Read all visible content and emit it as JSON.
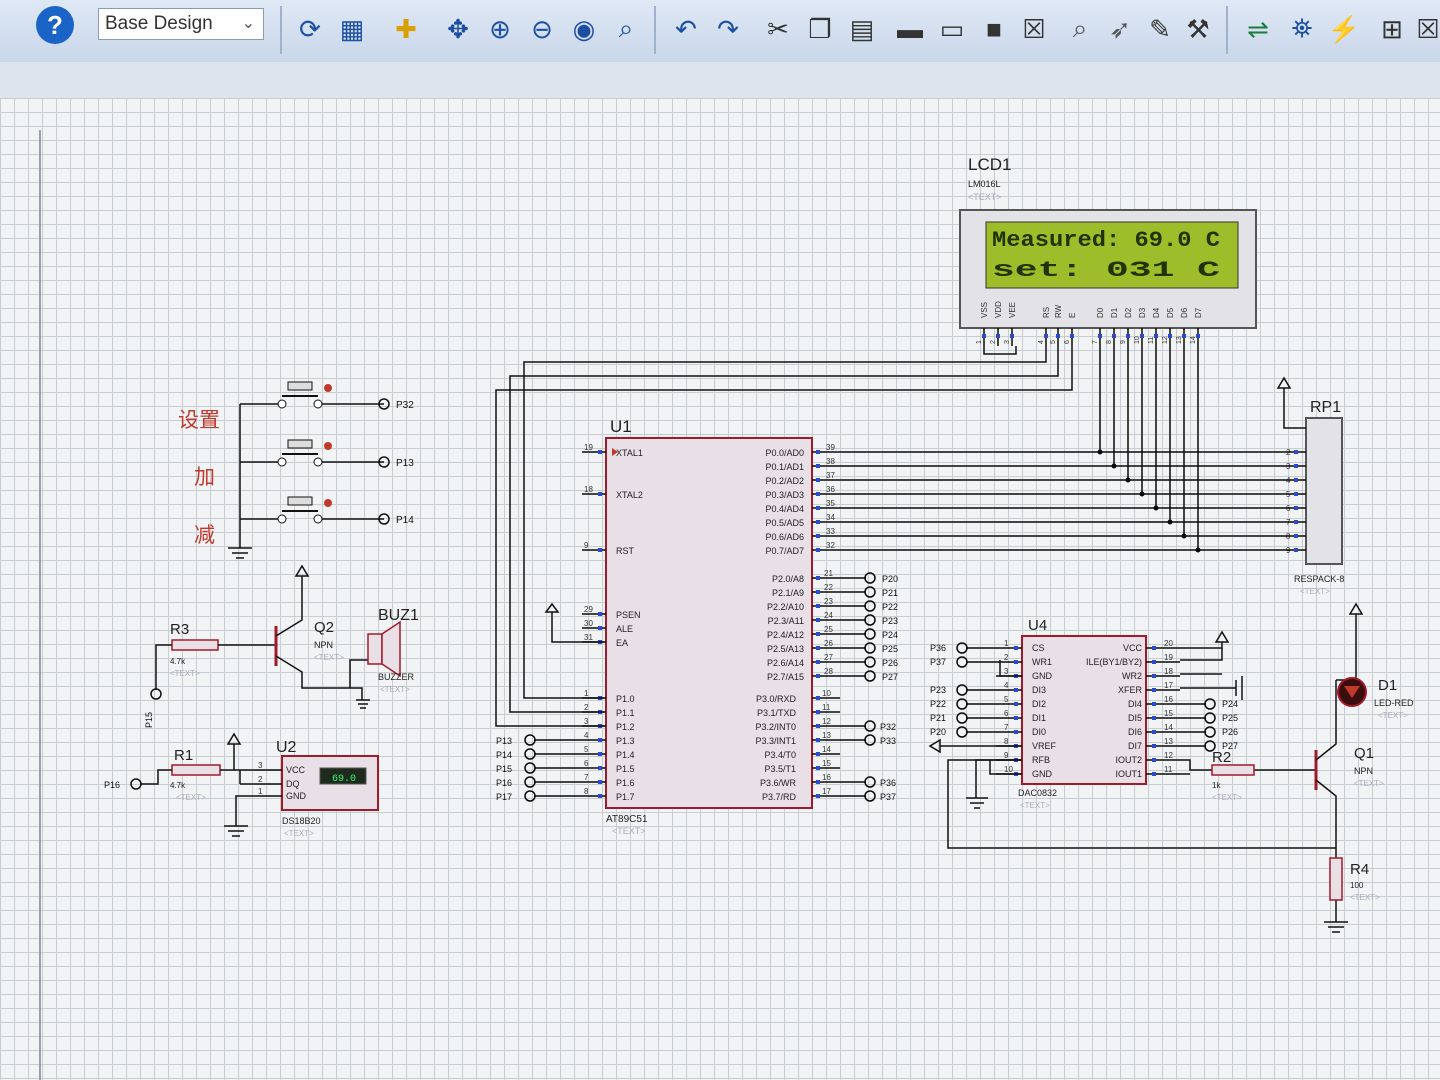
{
  "toolbar": {
    "help_label": "?",
    "design_select_value": "Base Design",
    "buttons": [
      "refresh",
      "grid",
      "origin",
      "pan",
      "zoom-in",
      "zoom-out",
      "zoom-all",
      "zoom-area",
      "undo",
      "redo",
      "cut",
      "copy",
      "paste",
      "block-copy",
      "block-move",
      "block-rotate",
      "block-delete",
      "pick",
      "make-device",
      "packaging",
      "decompose",
      "wire-autorouter",
      "search",
      "property-assignment",
      "new-sheet",
      "remove-sheet"
    ]
  },
  "colors": {
    "wire": "#0a0a0a",
    "component_outline": "#a11a2a",
    "component_fill": "#e9dfe6",
    "pin_marker": "#2b4bcc",
    "label_red": "#c0392b",
    "lcd_bg": "#9dbd2a",
    "lcd_text": "#223300"
  },
  "buttons": {
    "set_label": "设置",
    "inc_label": "加",
    "dec_label": "减",
    "set_terminal": "P32",
    "inc_terminal": "P13",
    "dec_terminal": "P14"
  },
  "lcd": {
    "ref": "LCD1",
    "part": "LM016L",
    "text_tag": "<TEXT>",
    "line1": "Measured: 69.0 C",
    "line2": "set:        031 C",
    "pins": [
      "VSS",
      "VDD",
      "VEE",
      "RS",
      "RW",
      "E",
      "D0",
      "D1",
      "D2",
      "D3",
      "D4",
      "D5",
      "D6",
      "D7"
    ],
    "pin_numbers": [
      "1",
      "2",
      "3",
      "4",
      "5",
      "6",
      "7",
      "8",
      "9",
      "10",
      "11",
      "12",
      "13",
      "14"
    ]
  },
  "mcu": {
    "ref": "U1",
    "part": "AT89C51",
    "text_tag": "<TEXT>",
    "left_pins": [
      {
        "num": "19",
        "name": "XTAL1"
      },
      {
        "num": "18",
        "name": "XTAL2"
      },
      {
        "num": "9",
        "name": "RST"
      },
      {
        "num": "29",
        "name": "PSEN"
      },
      {
        "num": "30",
        "name": "ALE"
      },
      {
        "num": "31",
        "name": "EA"
      },
      {
        "num": "1",
        "name": "P1.0"
      },
      {
        "num": "2",
        "name": "P1.1"
      },
      {
        "num": "3",
        "name": "P1.2"
      },
      {
        "num": "4",
        "name": "P1.3"
      },
      {
        "num": "5",
        "name": "P1.4"
      },
      {
        "num": "6",
        "name": "P1.5"
      },
      {
        "num": "7",
        "name": "P1.6"
      },
      {
        "num": "8",
        "name": "P1.7"
      }
    ],
    "p1_terminals": [
      "P13",
      "P14",
      "P15",
      "P16",
      "P17"
    ],
    "right_p0": [
      {
        "num": "39",
        "name": "P0.0/AD0"
      },
      {
        "num": "38",
        "name": "P0.1/AD1"
      },
      {
        "num": "37",
        "name": "P0.2/AD2"
      },
      {
        "num": "36",
        "name": "P0.3/AD3"
      },
      {
        "num": "35",
        "name": "P0.4/AD4"
      },
      {
        "num": "34",
        "name": "P0.5/AD5"
      },
      {
        "num": "33",
        "name": "P0.6/AD6"
      },
      {
        "num": "32",
        "name": "P0.7/AD7"
      }
    ],
    "right_p2": [
      {
        "num": "21",
        "name": "P2.0/A8",
        "term": "P20"
      },
      {
        "num": "22",
        "name": "P2.1/A9",
        "term": "P21"
      },
      {
        "num": "23",
        "name": "P2.2/A10",
        "term": "P22"
      },
      {
        "num": "24",
        "name": "P2.3/A11",
        "term": "P23"
      },
      {
        "num": "25",
        "name": "P2.4/A12",
        "term": "P24"
      },
      {
        "num": "26",
        "name": "P2.5/A13",
        "term": "P25"
      },
      {
        "num": "27",
        "name": "P2.6/A14",
        "term": "P26"
      },
      {
        "num": "28",
        "name": "P2.7/A15",
        "term": "P27"
      }
    ],
    "right_p3": [
      {
        "num": "10",
        "name": "P3.0/RXD",
        "term": ""
      },
      {
        "num": "11",
        "name": "P3.1/TXD",
        "term": ""
      },
      {
        "num": "12",
        "name": "P3.2/INT0",
        "term": "P32"
      },
      {
        "num": "13",
        "name": "P3.3/INT1",
        "term": "P33"
      },
      {
        "num": "14",
        "name": "P3.4/T0",
        "term": ""
      },
      {
        "num": "15",
        "name": "P3.5/T1",
        "term": ""
      },
      {
        "num": "16",
        "name": "P3.6/WR",
        "term": "P36"
      },
      {
        "num": "17",
        "name": "P3.7/RD",
        "term": "P37"
      }
    ]
  },
  "rp1": {
    "ref": "RP1",
    "part": "RESPACK-8",
    "text_tag": "<TEXT>",
    "pins": [
      "2",
      "3",
      "4",
      "5",
      "6",
      "7",
      "8",
      "9"
    ]
  },
  "q2": {
    "ref": "Q2",
    "part": "NPN",
    "text_tag": "<TEXT>"
  },
  "r3": {
    "ref": "R3",
    "value": "4.7k",
    "text_tag": "<TEXT>",
    "terminal": "P15"
  },
  "buz1": {
    "ref": "BUZ1",
    "part": "BUZZER",
    "text_tag": "<TEXT>"
  },
  "r1": {
    "ref": "R1",
    "value": "4.7k",
    "text_tag": "<TEXT>",
    "terminal": "P16"
  },
  "u2": {
    "ref": "U2",
    "part": "DS18B20",
    "text_tag": "<TEXT>",
    "reading": "69.0",
    "pins": [
      {
        "num": "3",
        "name": "VCC"
      },
      {
        "num": "2",
        "name": "DQ"
      },
      {
        "num": "1",
        "name": "GND"
      }
    ]
  },
  "dac": {
    "ref": "U4",
    "part": "DAC0832",
    "text_tag": "<TEXT>",
    "left_pins": [
      {
        "num": "1",
        "name": "CS",
        "term": "P36"
      },
      {
        "num": "2",
        "name": "WR1",
        "term": "P37"
      },
      {
        "num": "3",
        "name": "GND",
        "term": ""
      },
      {
        "num": "4",
        "name": "DI3",
        "term": "P23"
      },
      {
        "num": "5",
        "name": "DI2",
        "term": "P22"
      },
      {
        "num": "6",
        "name": "DI1",
        "term": "P21"
      },
      {
        "num": "7",
        "name": "DI0",
        "term": "P20"
      },
      {
        "num": "8",
        "name": "VREF",
        "term": ""
      },
      {
        "num": "9",
        "name": "RFB",
        "term": ""
      },
      {
        "num": "10",
        "name": "GND",
        "term": ""
      }
    ],
    "right_pins": [
      {
        "num": "20",
        "name": "VCC",
        "term": ""
      },
      {
        "num": "19",
        "name": "ILE(BY1/BY2)",
        "term": ""
      },
      {
        "num": "18",
        "name": "WR2",
        "term": ""
      },
      {
        "num": "17",
        "name": "XFER",
        "term": ""
      },
      {
        "num": "16",
        "name": "DI4",
        "term": "P24"
      },
      {
        "num": "15",
        "name": "DI5",
        "term": "P25"
      },
      {
        "num": "14",
        "name": "DI6",
        "term": "P26"
      },
      {
        "num": "13",
        "name": "DI7",
        "term": "P27"
      },
      {
        "num": "12",
        "name": "IOUT2",
        "term": ""
      },
      {
        "num": "11",
        "name": "IOUT1",
        "term": ""
      }
    ]
  },
  "r2": {
    "ref": "R2",
    "value": "1k",
    "text_tag": "<TEXT>"
  },
  "q1": {
    "ref": "Q1",
    "part": "NPN",
    "text_tag": "<TEXT>"
  },
  "d1": {
    "ref": "D1",
    "part": "LED-RED",
    "text_tag": "<TEXT>"
  },
  "r4": {
    "ref": "R4",
    "value": "100",
    "text_tag": "<TEXT>"
  }
}
